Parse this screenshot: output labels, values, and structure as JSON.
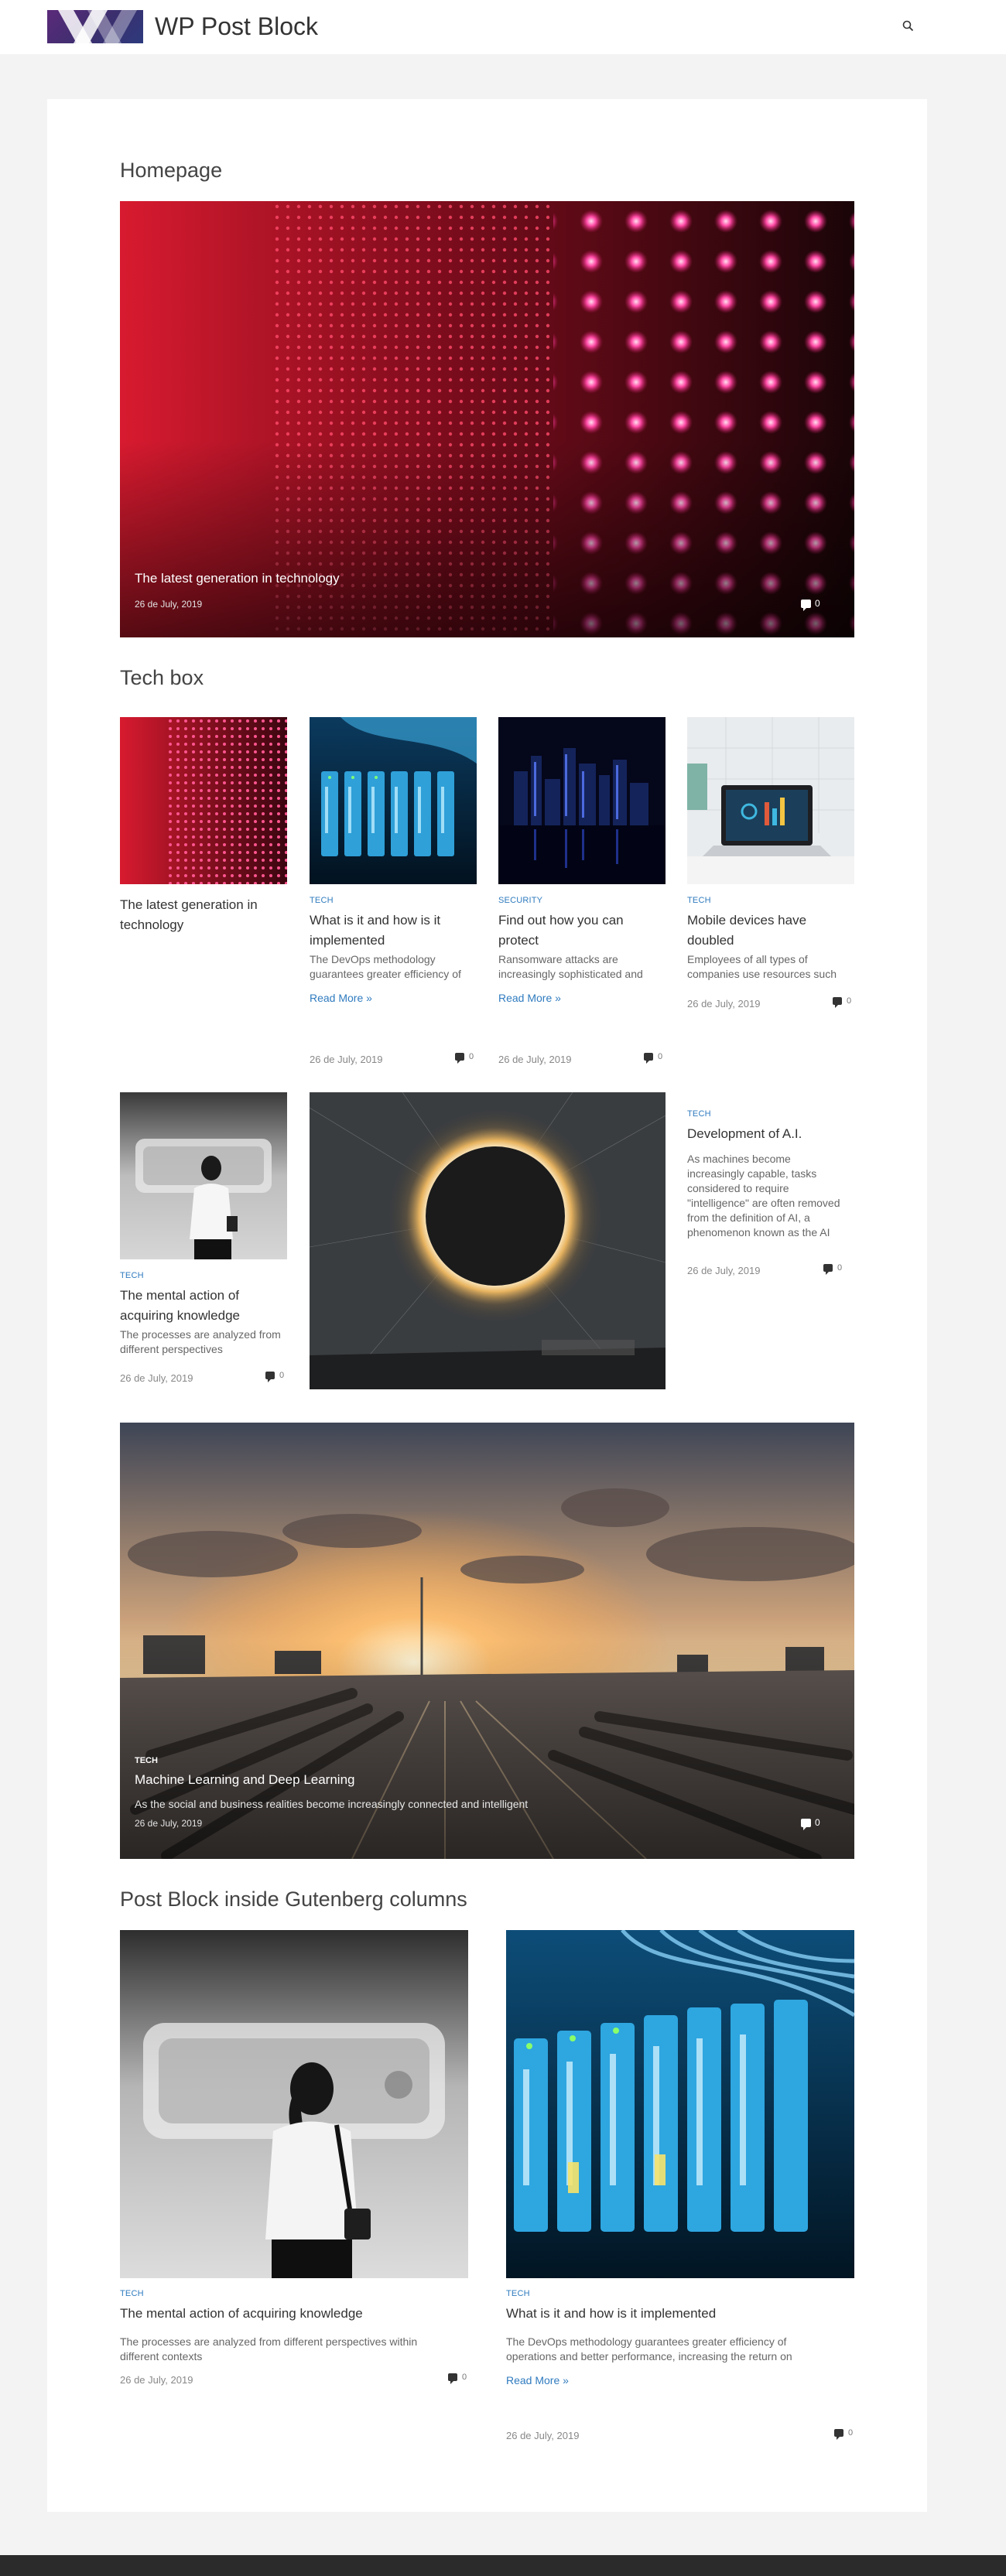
{
  "site": {
    "title": "WP Post Block"
  },
  "sections": {
    "homepage": "Homepage",
    "techbox": "Tech box",
    "gutenberg": "Post Block inside Gutenberg columns"
  },
  "hero": {
    "title": "The latest generation in technology",
    "date": "26 de July, 2019",
    "comments": "0"
  },
  "techbox": {
    "row1": [
      {
        "title": "The latest generation in technology"
      },
      {
        "category": "TECH",
        "title": "What is it and how is it implemented",
        "excerpt": "The DevOps methodology guarantees greater efficiency of",
        "readmore": "Read More »",
        "date": "26 de July, 2019",
        "comments": "0"
      },
      {
        "category": "SECURITY",
        "title": "Find out how you can protect",
        "excerpt": "Ransomware attacks are increasingly sophisticated and",
        "readmore": "Read More »",
        "date": "26 de July, 2019",
        "comments": "0"
      },
      {
        "category": "TECH",
        "title": "Mobile devices have doubled",
        "excerpt": "Employees of all types of companies use resources such",
        "date": "26 de July, 2019",
        "comments": "0"
      }
    ],
    "row2": [
      {
        "category": "TECH",
        "title": "The mental action of acquiring knowledge",
        "excerpt": "The processes are analyzed from different perspectives",
        "date": "26 de July, 2019",
        "comments": "0"
      },
      {
        "category": "TECH",
        "title": "Development of A.I.",
        "excerpt": "As machines become increasingly capable, tasks considered to require \"intelligence\" are often removed from the definition of AI, a phenomenon known as the AI effect",
        "date": "26 de July, 2019",
        "comments": "0"
      }
    ]
  },
  "feature": {
    "category": "TECH",
    "title": "Machine Learning and Deep Learning",
    "excerpt": "As the social and business realities become increasingly connected and intelligent",
    "date": "26 de July, 2019",
    "comments": "0"
  },
  "columns": [
    {
      "category": "TECH",
      "title": "The mental action of acquiring knowledge",
      "excerpt": "The processes are analyzed from different perspectives within different contexts",
      "date": "26 de July, 2019",
      "comments": "0"
    },
    {
      "category": "TECH",
      "title": "What is it and how is it implemented",
      "excerpt": "The DevOps methodology guarantees greater efficiency of operations and better performance, increasing the return on",
      "readmore": "Read More »",
      "date": "26 de July, 2019",
      "comments": "0"
    }
  ],
  "icons": {
    "search": "search-icon",
    "comment": "comment-icon"
  },
  "colors": {
    "accent": "#2f7bbf",
    "logo_purple": "#5b2a7a",
    "background": "#f3f3f3"
  }
}
